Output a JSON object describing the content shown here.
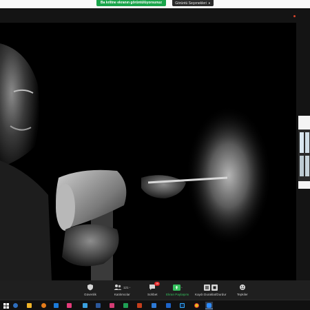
{
  "share_banner": {
    "text": "Ba kriltne ekranın görüntülüyorsunuz"
  },
  "view_options": {
    "label": "Görüntü Seçenekleri"
  },
  "toolbar": {
    "security": {
      "label": "Güvenlik",
      "icon": "shield-icon"
    },
    "participants": {
      "label": "Katılımcılar",
      "count": "121",
      "icon": "participants-icon"
    },
    "chat": {
      "label": "Sohbet",
      "badge": "15",
      "icon": "chat-icon"
    },
    "share": {
      "label": "Ekran Paylaşımı",
      "icon": "share-screen-icon",
      "color": "#36c25e"
    },
    "record": {
      "label": "Kaydı Duraklat/Durdur",
      "icon": "pause-stop-icon"
    },
    "reactions": {
      "label": "Tepkiler",
      "icon": "reaction-icon"
    }
  },
  "shared_content": {
    "description": "shared screen"
  },
  "taskbar": {
    "apps": [
      "windows-start-icon",
      "search-icon",
      "task-view-icon",
      "edge-icon",
      "store-icon",
      "plex-icon",
      "explorer-icon",
      "mail-icon",
      "instagram-icon",
      "photos-icon",
      "word-icon",
      "pdf-icon",
      "excel-icon",
      "powerpoint-icon",
      "onenote-icon",
      "email-icon",
      "browser-icon",
      "outlook-icon",
      "photoshop-icon",
      "chrome-icon",
      "zoom-icon"
    ]
  },
  "colors": {
    "accent": "#19a44a",
    "badge": "#e02020",
    "toolbar_bg": "#1f1f1f"
  }
}
